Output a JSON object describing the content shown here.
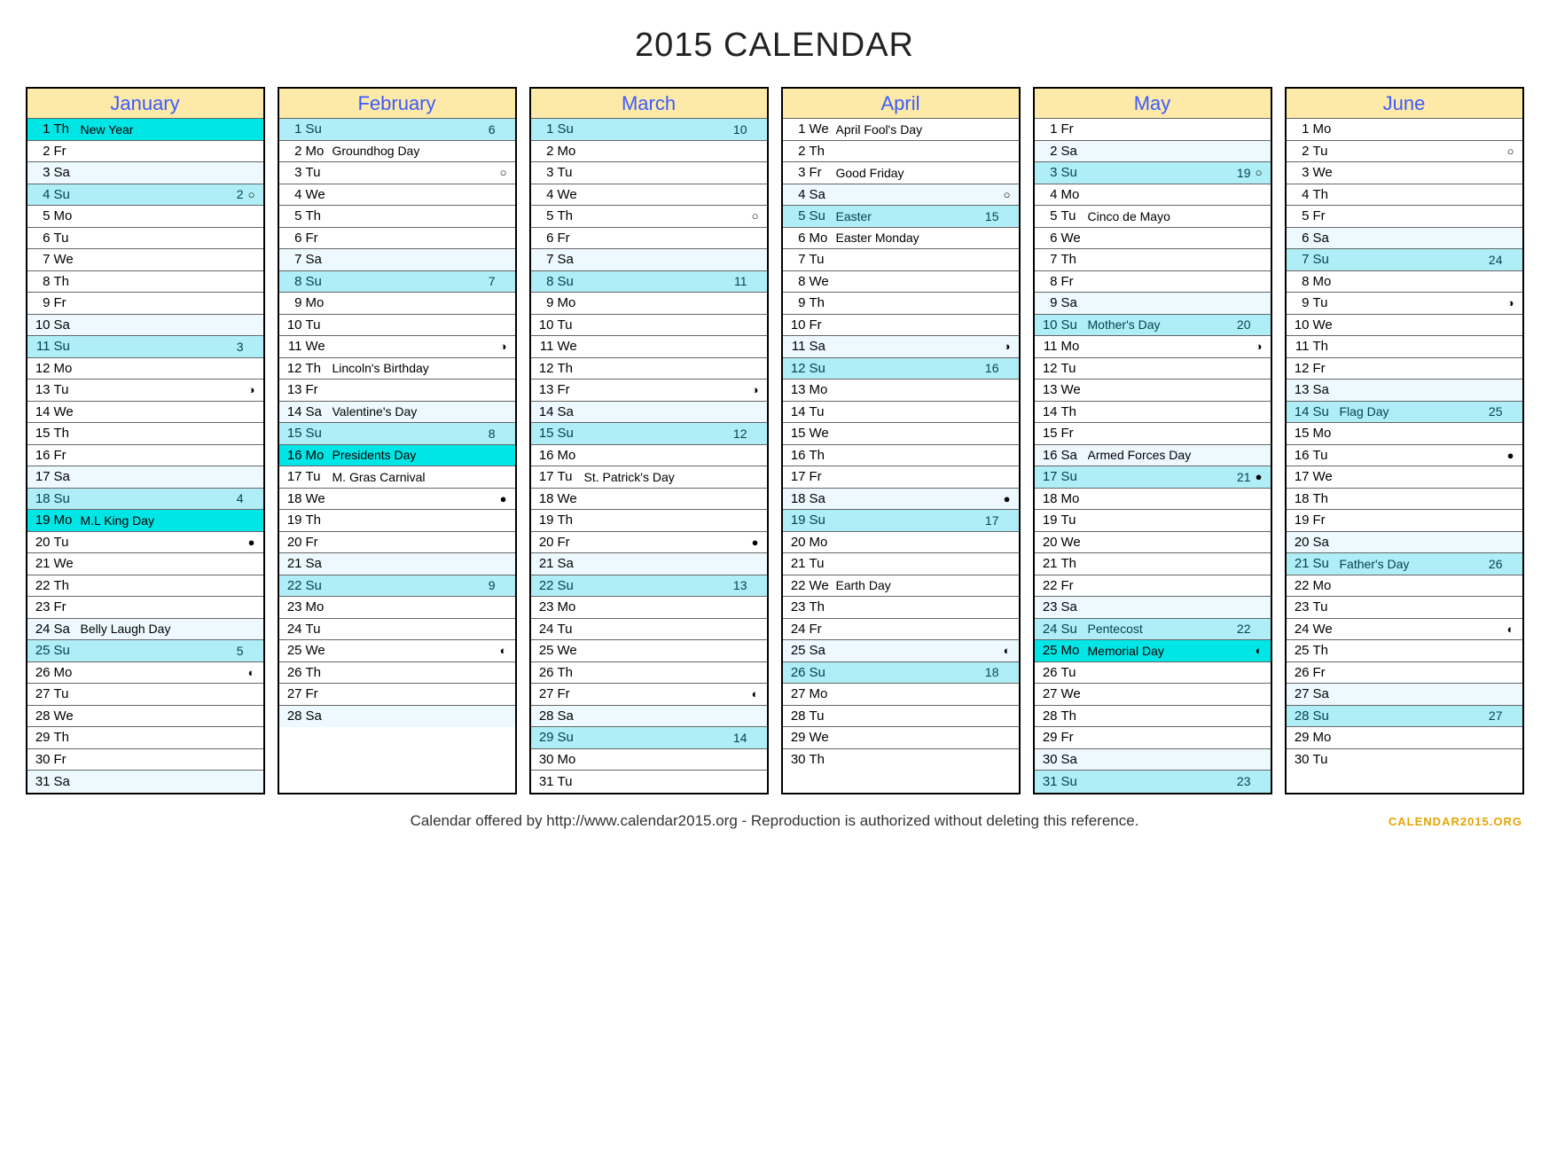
{
  "title": "2015 CALENDAR",
  "footer": "Calendar offered by http://www.calendar2015.org - Reproduction is authorized without deleting this reference.",
  "brand": "CALENDAR2015.ORG",
  "months": [
    {
      "name": "January",
      "days": [
        {
          "n": 1,
          "wd": "Th",
          "ev": "New Year",
          "hl": "holiday"
        },
        {
          "n": 2,
          "wd": "Fr"
        },
        {
          "n": 3,
          "wd": "Sa",
          "hl": "sat"
        },
        {
          "n": 4,
          "wd": "Su",
          "wk": 2,
          "moon": "○",
          "hl": "sun"
        },
        {
          "n": 5,
          "wd": "Mo"
        },
        {
          "n": 6,
          "wd": "Tu"
        },
        {
          "n": 7,
          "wd": "We"
        },
        {
          "n": 8,
          "wd": "Th"
        },
        {
          "n": 9,
          "wd": "Fr"
        },
        {
          "n": 10,
          "wd": "Sa",
          "hl": "sat"
        },
        {
          "n": 11,
          "wd": "Su",
          "wk": 3,
          "hl": "sun"
        },
        {
          "n": 12,
          "wd": "Mo"
        },
        {
          "n": 13,
          "wd": "Tu",
          "moon": "◑"
        },
        {
          "n": 14,
          "wd": "We"
        },
        {
          "n": 15,
          "wd": "Th"
        },
        {
          "n": 16,
          "wd": "Fr"
        },
        {
          "n": 17,
          "wd": "Sa",
          "hl": "sat"
        },
        {
          "n": 18,
          "wd": "Su",
          "wk": 4,
          "hl": "sun"
        },
        {
          "n": 19,
          "wd": "Mo",
          "ev": "M.L King Day",
          "hl": "holiday"
        },
        {
          "n": 20,
          "wd": "Tu",
          "moon": "●"
        },
        {
          "n": 21,
          "wd": "We"
        },
        {
          "n": 22,
          "wd": "Th"
        },
        {
          "n": 23,
          "wd": "Fr"
        },
        {
          "n": 24,
          "wd": "Sa",
          "ev": "Belly Laugh Day",
          "hl": "sat"
        },
        {
          "n": 25,
          "wd": "Su",
          "wk": 5,
          "hl": "sun"
        },
        {
          "n": 26,
          "wd": "Mo",
          "moon": "◐"
        },
        {
          "n": 27,
          "wd": "Tu"
        },
        {
          "n": 28,
          "wd": "We"
        },
        {
          "n": 29,
          "wd": "Th"
        },
        {
          "n": 30,
          "wd": "Fr"
        },
        {
          "n": 31,
          "wd": "Sa",
          "hl": "sat"
        }
      ]
    },
    {
      "name": "February",
      "days": [
        {
          "n": 1,
          "wd": "Su",
          "wk": 6,
          "hl": "sun"
        },
        {
          "n": 2,
          "wd": "Mo",
          "ev": "Groundhog Day"
        },
        {
          "n": 3,
          "wd": "Tu",
          "moon": "○"
        },
        {
          "n": 4,
          "wd": "We"
        },
        {
          "n": 5,
          "wd": "Th"
        },
        {
          "n": 6,
          "wd": "Fr"
        },
        {
          "n": 7,
          "wd": "Sa",
          "hl": "sat"
        },
        {
          "n": 8,
          "wd": "Su",
          "wk": 7,
          "hl": "sun"
        },
        {
          "n": 9,
          "wd": "Mo"
        },
        {
          "n": 10,
          "wd": "Tu"
        },
        {
          "n": 11,
          "wd": "We",
          "moon": "◑"
        },
        {
          "n": 12,
          "wd": "Th",
          "ev": "Lincoln's Birthday"
        },
        {
          "n": 13,
          "wd": "Fr"
        },
        {
          "n": 14,
          "wd": "Sa",
          "ev": "Valentine's Day",
          "hl": "sat"
        },
        {
          "n": 15,
          "wd": "Su",
          "wk": 8,
          "hl": "sun"
        },
        {
          "n": 16,
          "wd": "Mo",
          "ev": "Presidents Day",
          "hl": "holiday"
        },
        {
          "n": 17,
          "wd": "Tu",
          "ev": "M. Gras Carnival"
        },
        {
          "n": 18,
          "wd": "We",
          "moon": "●"
        },
        {
          "n": 19,
          "wd": "Th"
        },
        {
          "n": 20,
          "wd": "Fr"
        },
        {
          "n": 21,
          "wd": "Sa",
          "hl": "sat"
        },
        {
          "n": 22,
          "wd": "Su",
          "wk": 9,
          "hl": "sun"
        },
        {
          "n": 23,
          "wd": "Mo"
        },
        {
          "n": 24,
          "wd": "Tu"
        },
        {
          "n": 25,
          "wd": "We",
          "moon": "◐"
        },
        {
          "n": 26,
          "wd": "Th"
        },
        {
          "n": 27,
          "wd": "Fr"
        },
        {
          "n": 28,
          "wd": "Sa",
          "hl": "sat"
        }
      ]
    },
    {
      "name": "March",
      "days": [
        {
          "n": 1,
          "wd": "Su",
          "wk": 10,
          "hl": "sun"
        },
        {
          "n": 2,
          "wd": "Mo"
        },
        {
          "n": 3,
          "wd": "Tu"
        },
        {
          "n": 4,
          "wd": "We"
        },
        {
          "n": 5,
          "wd": "Th",
          "moon": "○"
        },
        {
          "n": 6,
          "wd": "Fr"
        },
        {
          "n": 7,
          "wd": "Sa",
          "hl": "sat"
        },
        {
          "n": 8,
          "wd": "Su",
          "wk": 11,
          "hl": "sun"
        },
        {
          "n": 9,
          "wd": "Mo"
        },
        {
          "n": 10,
          "wd": "Tu"
        },
        {
          "n": 11,
          "wd": "We"
        },
        {
          "n": 12,
          "wd": "Th"
        },
        {
          "n": 13,
          "wd": "Fr",
          "moon": "◑"
        },
        {
          "n": 14,
          "wd": "Sa",
          "hl": "sat"
        },
        {
          "n": 15,
          "wd": "Su",
          "wk": 12,
          "hl": "sun"
        },
        {
          "n": 16,
          "wd": "Mo"
        },
        {
          "n": 17,
          "wd": "Tu",
          "ev": "St. Patrick's Day"
        },
        {
          "n": 18,
          "wd": "We"
        },
        {
          "n": 19,
          "wd": "Th"
        },
        {
          "n": 20,
          "wd": "Fr",
          "moon": "●"
        },
        {
          "n": 21,
          "wd": "Sa",
          "hl": "sat"
        },
        {
          "n": 22,
          "wd": "Su",
          "wk": 13,
          "hl": "sun"
        },
        {
          "n": 23,
          "wd": "Mo"
        },
        {
          "n": 24,
          "wd": "Tu"
        },
        {
          "n": 25,
          "wd": "We"
        },
        {
          "n": 26,
          "wd": "Th"
        },
        {
          "n": 27,
          "wd": "Fr",
          "moon": "◐"
        },
        {
          "n": 28,
          "wd": "Sa",
          "hl": "sat"
        },
        {
          "n": 29,
          "wd": "Su",
          "wk": 14,
          "hl": "sun"
        },
        {
          "n": 30,
          "wd": "Mo"
        },
        {
          "n": 31,
          "wd": "Tu"
        }
      ]
    },
    {
      "name": "April",
      "days": [
        {
          "n": 1,
          "wd": "We",
          "ev": "April Fool's Day"
        },
        {
          "n": 2,
          "wd": "Th"
        },
        {
          "n": 3,
          "wd": "Fr",
          "ev": "Good Friday"
        },
        {
          "n": 4,
          "wd": "Sa",
          "moon": "○",
          "hl": "sat"
        },
        {
          "n": 5,
          "wd": "Su",
          "ev": "Easter",
          "wk": 15,
          "hl": "sun"
        },
        {
          "n": 6,
          "wd": "Mo",
          "ev": "Easter Monday"
        },
        {
          "n": 7,
          "wd": "Tu"
        },
        {
          "n": 8,
          "wd": "We"
        },
        {
          "n": 9,
          "wd": "Th"
        },
        {
          "n": 10,
          "wd": "Fr"
        },
        {
          "n": 11,
          "wd": "Sa",
          "moon": "◑",
          "hl": "sat"
        },
        {
          "n": 12,
          "wd": "Su",
          "wk": 16,
          "hl": "sun"
        },
        {
          "n": 13,
          "wd": "Mo"
        },
        {
          "n": 14,
          "wd": "Tu"
        },
        {
          "n": 15,
          "wd": "We"
        },
        {
          "n": 16,
          "wd": "Th"
        },
        {
          "n": 17,
          "wd": "Fr"
        },
        {
          "n": 18,
          "wd": "Sa",
          "moon": "●",
          "hl": "sat"
        },
        {
          "n": 19,
          "wd": "Su",
          "wk": 17,
          "hl": "sun"
        },
        {
          "n": 20,
          "wd": "Mo"
        },
        {
          "n": 21,
          "wd": "Tu"
        },
        {
          "n": 22,
          "wd": "We",
          "ev": "Earth Day"
        },
        {
          "n": 23,
          "wd": "Th"
        },
        {
          "n": 24,
          "wd": "Fr"
        },
        {
          "n": 25,
          "wd": "Sa",
          "moon": "◐",
          "hl": "sat"
        },
        {
          "n": 26,
          "wd": "Su",
          "wk": 18,
          "hl": "sun"
        },
        {
          "n": 27,
          "wd": "Mo"
        },
        {
          "n": 28,
          "wd": "Tu"
        },
        {
          "n": 29,
          "wd": "We"
        },
        {
          "n": 30,
          "wd": "Th"
        }
      ]
    },
    {
      "name": "May",
      "days": [
        {
          "n": 1,
          "wd": "Fr"
        },
        {
          "n": 2,
          "wd": "Sa",
          "hl": "sat"
        },
        {
          "n": 3,
          "wd": "Su",
          "wk": 19,
          "moon": "○",
          "hl": "sun"
        },
        {
          "n": 4,
          "wd": "Mo"
        },
        {
          "n": 5,
          "wd": "Tu",
          "ev": "Cinco de Mayo"
        },
        {
          "n": 6,
          "wd": "We"
        },
        {
          "n": 7,
          "wd": "Th"
        },
        {
          "n": 8,
          "wd": "Fr"
        },
        {
          "n": 9,
          "wd": "Sa",
          "hl": "sat"
        },
        {
          "n": 10,
          "wd": "Su",
          "ev": "Mother's Day",
          "wk": 20,
          "hl": "sun"
        },
        {
          "n": 11,
          "wd": "Mo",
          "moon": "◑"
        },
        {
          "n": 12,
          "wd": "Tu"
        },
        {
          "n": 13,
          "wd": "We"
        },
        {
          "n": 14,
          "wd": "Th"
        },
        {
          "n": 15,
          "wd": "Fr"
        },
        {
          "n": 16,
          "wd": "Sa",
          "ev": "Armed Forces Day",
          "hl": "sat"
        },
        {
          "n": 17,
          "wd": "Su",
          "wk": 21,
          "moon": "●",
          "hl": "sun"
        },
        {
          "n": 18,
          "wd": "Mo"
        },
        {
          "n": 19,
          "wd": "Tu"
        },
        {
          "n": 20,
          "wd": "We"
        },
        {
          "n": 21,
          "wd": "Th"
        },
        {
          "n": 22,
          "wd": "Fr"
        },
        {
          "n": 23,
          "wd": "Sa",
          "hl": "sat"
        },
        {
          "n": 24,
          "wd": "Su",
          "ev": "Pentecost",
          "wk": 22,
          "hl": "sun"
        },
        {
          "n": 25,
          "wd": "Mo",
          "ev": "Memorial Day",
          "moon": "◐",
          "hl": "holiday"
        },
        {
          "n": 26,
          "wd": "Tu"
        },
        {
          "n": 27,
          "wd": "We"
        },
        {
          "n": 28,
          "wd": "Th"
        },
        {
          "n": 29,
          "wd": "Fr"
        },
        {
          "n": 30,
          "wd": "Sa",
          "hl": "sat"
        },
        {
          "n": 31,
          "wd": "Su",
          "wk": 23,
          "hl": "sun"
        }
      ]
    },
    {
      "name": "June",
      "days": [
        {
          "n": 1,
          "wd": "Mo"
        },
        {
          "n": 2,
          "wd": "Tu",
          "moon": "○"
        },
        {
          "n": 3,
          "wd": "We"
        },
        {
          "n": 4,
          "wd": "Th"
        },
        {
          "n": 5,
          "wd": "Fr"
        },
        {
          "n": 6,
          "wd": "Sa",
          "hl": "sat"
        },
        {
          "n": 7,
          "wd": "Su",
          "wk": 24,
          "hl": "sun"
        },
        {
          "n": 8,
          "wd": "Mo"
        },
        {
          "n": 9,
          "wd": "Tu",
          "moon": "◑"
        },
        {
          "n": 10,
          "wd": "We"
        },
        {
          "n": 11,
          "wd": "Th"
        },
        {
          "n": 12,
          "wd": "Fr"
        },
        {
          "n": 13,
          "wd": "Sa",
          "hl": "sat"
        },
        {
          "n": 14,
          "wd": "Su",
          "ev": "Flag Day",
          "wk": 25,
          "hl": "sun"
        },
        {
          "n": 15,
          "wd": "Mo"
        },
        {
          "n": 16,
          "wd": "Tu",
          "moon": "●"
        },
        {
          "n": 17,
          "wd": "We"
        },
        {
          "n": 18,
          "wd": "Th"
        },
        {
          "n": 19,
          "wd": "Fr"
        },
        {
          "n": 20,
          "wd": "Sa",
          "hl": "sat"
        },
        {
          "n": 21,
          "wd": "Su",
          "ev": "Father's Day",
          "wk": 26,
          "hl": "sun"
        },
        {
          "n": 22,
          "wd": "Mo"
        },
        {
          "n": 23,
          "wd": "Tu"
        },
        {
          "n": 24,
          "wd": "We",
          "moon": "◐"
        },
        {
          "n": 25,
          "wd": "Th"
        },
        {
          "n": 26,
          "wd": "Fr"
        },
        {
          "n": 27,
          "wd": "Sa",
          "hl": "sat"
        },
        {
          "n": 28,
          "wd": "Su",
          "wk": 27,
          "hl": "sun"
        },
        {
          "n": 29,
          "wd": "Mo"
        },
        {
          "n": 30,
          "wd": "Tu"
        }
      ]
    }
  ]
}
